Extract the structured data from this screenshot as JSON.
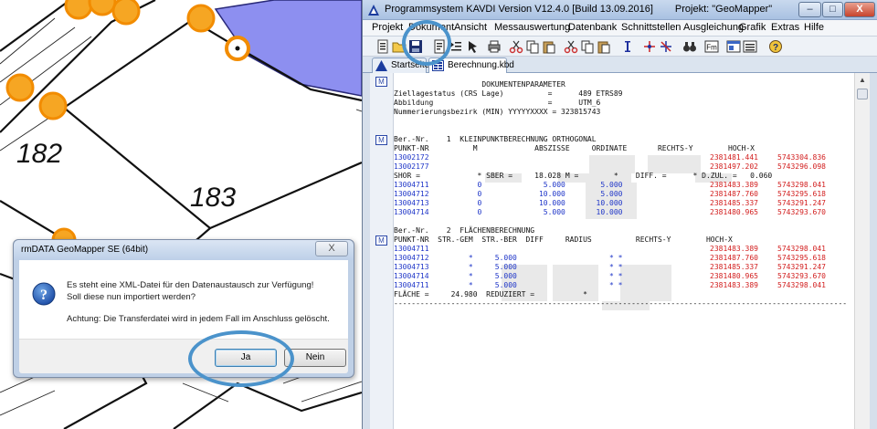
{
  "map": {
    "parcel_labels": [
      "182",
      "183"
    ]
  },
  "kavdi": {
    "title": "Programmsystem KAVDI Version V12.4.0 [Build 13.09.2016]",
    "project": "Projekt: \"GeoMapper\"",
    "window_buttons": {
      "minimize": "–",
      "maximize": "□",
      "close": "X"
    },
    "menu": [
      "Projekt",
      "Dokument",
      "Ansicht",
      "Messauswertung",
      "Datenbank",
      "Schnittstellen",
      "Ausgleichung",
      "Grafik",
      "Extras",
      "Hilfe"
    ],
    "tabs": [
      {
        "label": "Startseite",
        "icon": "home-triangle-icon"
      },
      {
        "label": "Berechnung.kbd",
        "icon": "document-grid-icon"
      }
    ],
    "doc_markers": [
      "M",
      "M",
      "M"
    ],
    "scroll_arrows": {
      "up": "▲",
      "down": "▼"
    },
    "document_lines": [
      {
        "text": "                    DOKUMENTENPARAMETER",
        "cls": "c-black"
      },
      {
        "text": "Ziellagestatus (CRS Lage)          =      489 ETRS89",
        "cls": "c-black"
      },
      {
        "text": "Abbildung                          =      UTM_6",
        "cls": "c-black"
      },
      {
        "text": "Nummerierungsbezirk (MIN) YYYYYXXXX = 323815743",
        "cls": "c-black"
      },
      {
        "text": "",
        "cls": "c-black"
      },
      {
        "text": "",
        "cls": "c-black"
      },
      {
        "text": "Ber.-Nr.    1  KLEINPUNKTBERECHNUNG ORTHOGONAL",
        "cls": "c-black"
      },
      {
        "text": "PUNKT-NR          M             ABSZISSE     ORDINATE       RECHTS-Y        HOCH-X",
        "cls": "c-black"
      },
      {
        "text": "13002172",
        "cls": "c-blue"
      },
      {
        "text": "13002177",
        "cls": "c-blue"
      },
      {
        "text": "SHOR =             * SBER =     18.028 M =        *    DIFF. =      * D.ZUL. =   0.060",
        "cls": "c-black"
      },
      {
        "text": "13004711           0              5.000        5.000",
        "cls": "c-blue"
      },
      {
        "text": "13004712           0             10.000        5.000",
        "cls": "c-blue"
      },
      {
        "text": "13004713           0             10.000       10.000",
        "cls": "c-blue"
      },
      {
        "text": "13004714           0              5.000       10.000",
        "cls": "c-blue"
      },
      {
        "text": "",
        "cls": "c-black"
      },
      {
        "text": "Ber.-Nr.    2  FLÄCHENBERECHNUNG",
        "cls": "c-black"
      },
      {
        "text": "PUNKT-NR  STR.-GEM  STR.-BER  DIFF     RADIUS          RECHTS-Y        HOCH-X",
        "cls": "c-black"
      },
      {
        "text": "13004711",
        "cls": "c-blue"
      },
      {
        "text": "13004712         *     5.000                     * *",
        "cls": "c-blue"
      },
      {
        "text": "13004713         *     5.000                     * *",
        "cls": "c-blue"
      },
      {
        "text": "13004714         *     5.000                     * *",
        "cls": "c-blue"
      },
      {
        "text": "13004711         *     5.000                     * *",
        "cls": "c-blue"
      },
      {
        "text": "FLÄCHE =     24.980  REDUZIERT =           *",
        "cls": "c-black"
      },
      {
        "text": "-------------------------------------------------------------------------------------------------------",
        "cls": "c-black"
      }
    ],
    "coordinates": [
      {
        "row": 8,
        "y": "2381481.441",
        "x": "5743304.836"
      },
      {
        "row": 9,
        "y": "2381497.202",
        "x": "5743296.098"
      },
      {
        "row": 11,
        "y": "2381483.389",
        "x": "5743298.041"
      },
      {
        "row": 12,
        "y": "2381487.760",
        "x": "5743295.618"
      },
      {
        "row": 13,
        "y": "2381485.337",
        "x": "5743291.247"
      },
      {
        "row": 14,
        "y": "2381480.965",
        "x": "5743293.670"
      },
      {
        "row": 18,
        "y": "2381483.389",
        "x": "5743298.041"
      },
      {
        "row": 19,
        "y": "2381487.760",
        "x": "5743295.618"
      },
      {
        "row": 20,
        "y": "2381485.337",
        "x": "5743291.247"
      },
      {
        "row": 21,
        "y": "2381480.965",
        "x": "5743293.670"
      },
      {
        "row": 22,
        "y": "2381483.389",
        "x": "5743298.041"
      }
    ]
  },
  "dialog": {
    "title": "rmDATA GeoMapper SE (64bit)",
    "message_1": "Es steht eine XML-Datei für den Datenaustausch zur Verfügung!",
    "message_2": "Soll diese nun importiert werden?",
    "message_3": "Achtung: Die Transferdatei wird in jedem Fall im Anschluss gelöscht.",
    "close_label": "X",
    "yes_label": "Ja",
    "no_label": "Nein"
  },
  "colors": {
    "highlight": "#4b93cb",
    "point_fill": "#f6a623",
    "point_stroke": "#f28c00",
    "area_fill": "#8d8ff0",
    "doc_blue": "#1e35c8",
    "doc_red": "#d21d1d"
  }
}
